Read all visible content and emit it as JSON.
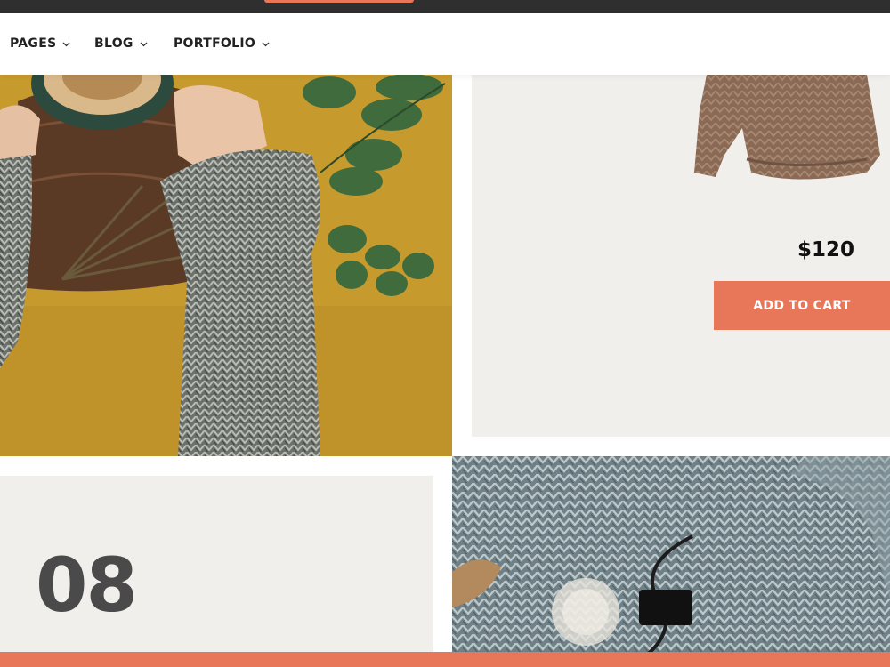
{
  "nav": {
    "items": [
      {
        "label": "PAGES"
      },
      {
        "label": "BLOG"
      },
      {
        "label": "PORTFOLIO"
      }
    ]
  },
  "product": {
    "price": "$120",
    "cta_label": "ADD TO CART",
    "image": "brown-knit-sweater"
  },
  "post": {
    "number": "08"
  },
  "images": {
    "left_photo": "hands-in-knit-sweater-with-coffee-and-leaves",
    "right_photo": "grey-knit-scarf-with-light-bulb"
  },
  "colors": {
    "accent": "#e8775a",
    "card_bg": "#f1efeb",
    "topbar": "#2f2f2f"
  }
}
